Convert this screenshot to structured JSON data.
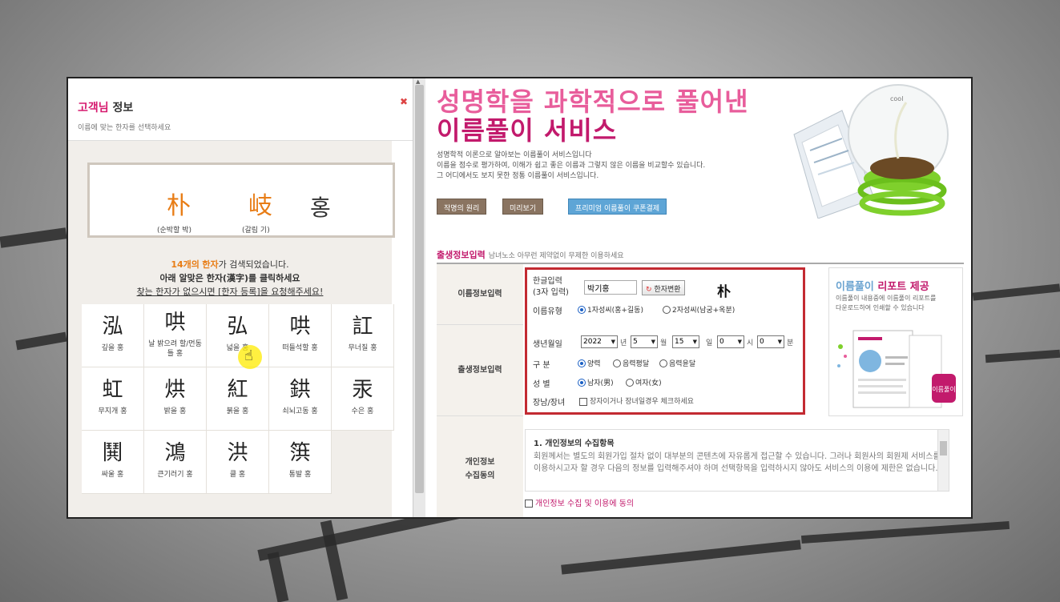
{
  "popup": {
    "title_accent": "고객님",
    "title_rest": " 정보",
    "subtitle": "이름에 맞는 한자를 선택하세요",
    "close_icon": "close-x-icon",
    "selected": [
      {
        "char": "朴",
        "gloss": "(순박할 박)"
      },
      {
        "char": "岐",
        "gloss": "(갈림 기)"
      },
      {
        "char": "홍",
        "gloss": ""
      }
    ],
    "result_count": "14개의",
    "result_word": "한자",
    "result_rest": "가 검색되었습니다.",
    "instruction": "아래 알맞은 한자(漢字)를 클릭하세요",
    "request_line": "찾는 한자가 없으시면 [한자 등록]을 요청해주세요!",
    "hanja_list": [
      {
        "char": "泓",
        "gloss": "깊을 홍"
      },
      {
        "char": "哄",
        "gloss": "날 밝으려 할/먼동 틀 홍"
      },
      {
        "char": "弘",
        "gloss": "넓을 홍"
      },
      {
        "char": "哄",
        "gloss": "떠들석할 홍"
      },
      {
        "char": "訌",
        "gloss": "무너질 홍"
      },
      {
        "char": "虹",
        "gloss": "무지개 홍"
      },
      {
        "char": "烘",
        "gloss": "밝을 홍"
      },
      {
        "char": "紅",
        "gloss": "붉을 홍"
      },
      {
        "char": "鉷",
        "gloss": "쇠뇌고동 홍"
      },
      {
        "char": "汞",
        "gloss": "수은 홍"
      },
      {
        "char": "鬨",
        "gloss": "싸울 홍"
      },
      {
        "char": "鴻",
        "gloss": "큰기러기 홍"
      },
      {
        "char": "洪",
        "gloss": "클 홍"
      },
      {
        "char": "篊",
        "gloss": "통발 홍"
      }
    ]
  },
  "page": {
    "hero_line1": "성명학을 과학적으로 풀어낸",
    "hero_line2": "이름풀이 서비스",
    "desc1": "성명학적 이론으로 알아보는 이름풀이 서비스입니다",
    "desc2": "이름을 점수로 평가하여, 이해가 쉽고 좋은 이름과 그렇지 않은 이름을 비교할수 있습니다.",
    "desc3": "그 어디에서도 보지 못한 정통 이름풀이 서비스입니다.",
    "btn_principle": "작명의 원리",
    "btn_preview": "미리보기",
    "btn_premium": "프리미엄 이름풀이 쿠폰결제",
    "section_title": "출생정보입력",
    "section_sub": "남녀노소 아무런 제약없이 무제한 이용하세요",
    "form": {
      "name_section": "이름정보입력",
      "birth_section": "출생정보입력",
      "privacy_section_1": "개인정보",
      "privacy_section_2": "수집동의",
      "hangul_label_1": "한글입력",
      "hangul_label_2": "(3자 입력)",
      "name_value": "박기홍",
      "hanja_button": "한자변환",
      "converted_char": "朴",
      "name_type_label": "이름유형",
      "name_type_opt1": "1자성씨(홍+길동)",
      "name_type_opt2": "2자성씨(남궁+옥분)",
      "birth_label": "생년월일",
      "year": "2022",
      "month": "5",
      "day": "15",
      "hour": "0",
      "minute": "0",
      "unit_year": "년",
      "unit_month": "월",
      "unit_day": "일",
      "unit_hour": "시",
      "unit_minute": "분",
      "calendar_label": "구 분",
      "cal_opt1": "양력",
      "cal_opt2": "음력평달",
      "cal_opt3": "음력윤달",
      "gender_label": "성 별",
      "gender_opt1": "남자(男)",
      "gender_opt2": "여자(女)",
      "eldest_label": "장남/장녀",
      "eldest_check": "장자이거나 장녀일경우 체크하세요",
      "report_title_a": "이름풀이",
      "report_title_b": "리포트 제공",
      "report_desc1": "이름풀이 내용중에 이름풀이 리포트를",
      "report_desc2": "다운로드하여 인쇄할 수 있습니다",
      "report_badge": "이름풀이",
      "privacy_heading": "1. 개인정보의 수집항목",
      "privacy_text": "회원께서는 별도의 회원가입 절차 없이 대부분의 콘텐츠에 자유롭게 접근할 수 있습니다. 그러나 회원사의 회원제 서비스를 이용하시고자 할 경우 다음의 정보를 입력해주셔야 하며 선택항목을 입력하시지 않아도 서비스의 이용에 제한은 없습니다.",
      "agree_label": "개인정보 수집 및 이용에 동의"
    }
  }
}
